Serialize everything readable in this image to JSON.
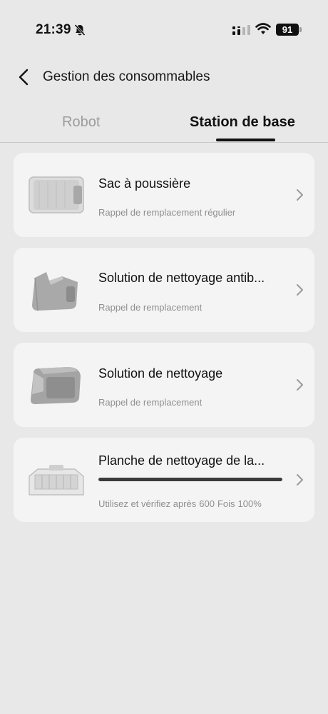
{
  "status_bar": {
    "time": "21:39",
    "battery": "91"
  },
  "header": {
    "title": "Gestion des consommables"
  },
  "tabs": [
    {
      "label": "Robot",
      "active": false
    },
    {
      "label": "Station de base",
      "active": true
    }
  ],
  "items": [
    {
      "title": "Sac à poussière",
      "subtitle": "Rappel de remplacement régulier",
      "icon": "dust-bag-image"
    },
    {
      "title": "Solution de nettoyage antib...",
      "subtitle": "Rappel de remplacement",
      "icon": "antibacterial-solution-image"
    },
    {
      "title": "Solution de nettoyage",
      "subtitle": "Rappel de remplacement",
      "icon": "cleaning-solution-image"
    },
    {
      "title": "Planche de nettoyage de la...",
      "progress": 1.0,
      "usage_prefix": "Utilisez et vérifiez après",
      "usage_count": "600",
      "usage_unit": "Fois",
      "usage_percent": "100%",
      "icon": "cleaning-board-image"
    }
  ],
  "colors": {
    "background": "#e8e8e8",
    "card": "#f4f4f4",
    "active_tab": "#111111",
    "inactive_tab": "#9c9c9c",
    "progress": "#3a3a3a"
  }
}
